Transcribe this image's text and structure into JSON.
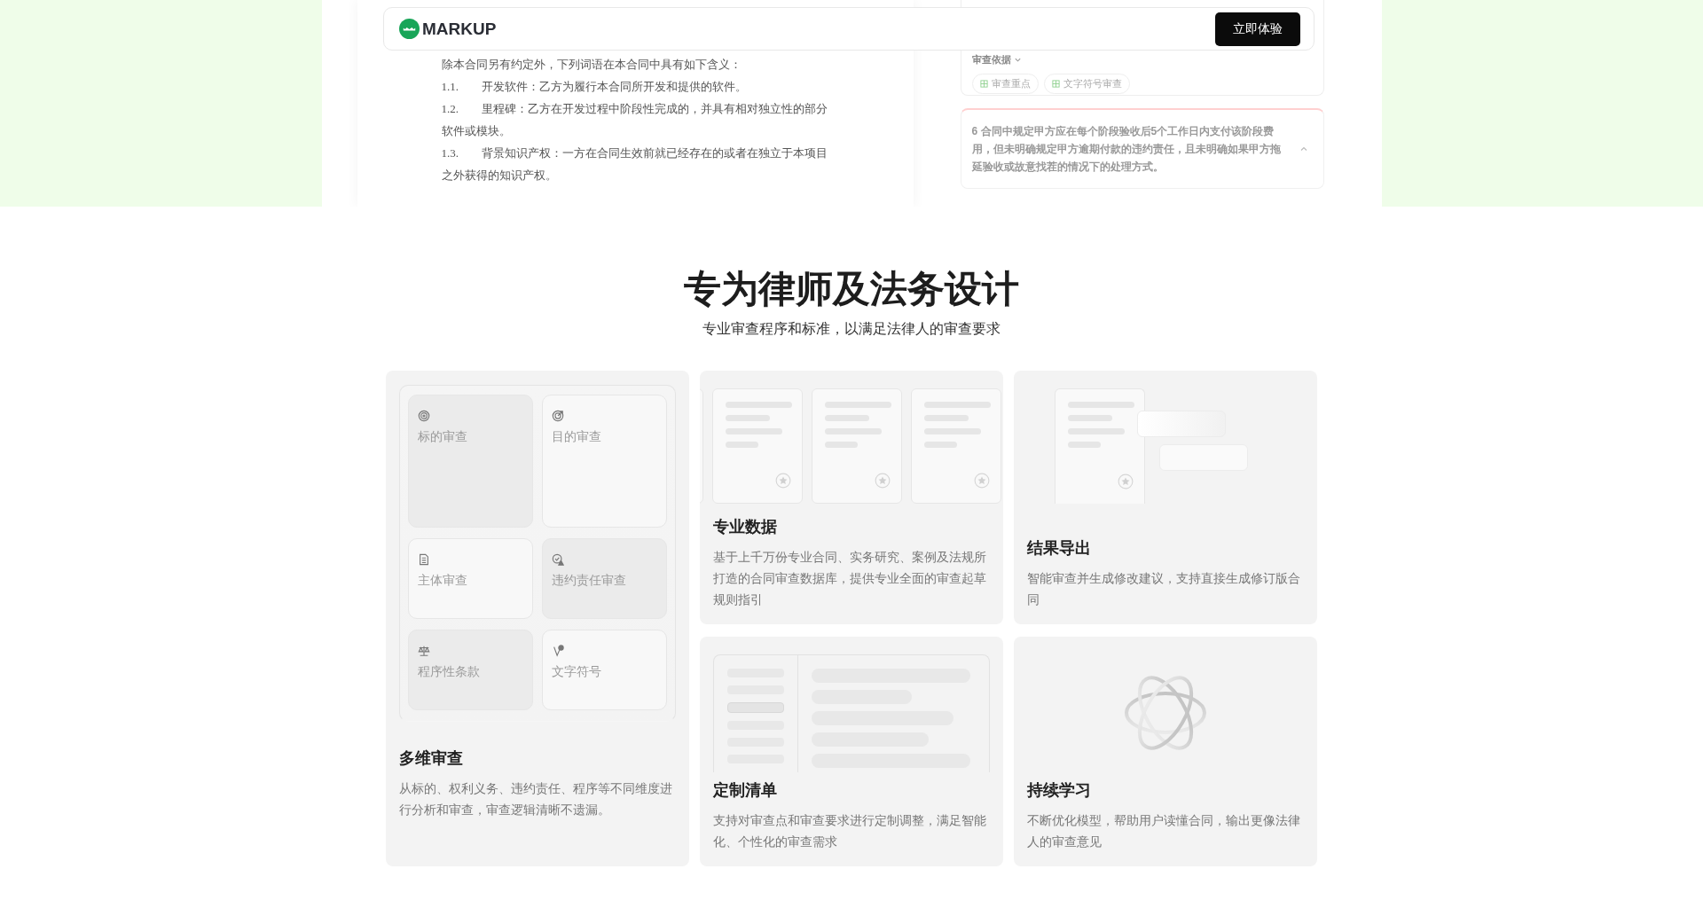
{
  "hero": {
    "document": {
      "lines": [
        {
          "text": "除本合同另有约定外，下列词语在本合同中具有如下含义："
        },
        {
          "number": "1.1.",
          "text": "开发软件：乙方为履行本合同所开发和提供的软件。"
        },
        {
          "number": "1.2.",
          "text": "里程碑：乙方在开发过程中阶段性完成的，并具有相对独立性的部分软件或模块。"
        },
        {
          "number": "1.3.",
          "text": "背景知识产权：一方在合同生效前就已经存在的或者在独立于本项目之外获得的知识产权。"
        }
      ]
    },
    "review_panel": {
      "basis_label": "审查依据",
      "tags": [
        "审查重点",
        "文字符号审查"
      ],
      "issue": {
        "text": "6 合同中规定甲方应在每个阶段验收后5个工作日内支付该阶段费用，但未明确规定甲方逾期付款的违约责任，且未明确如果甲方拖延验收或故意找茬的情况下的处理方式。",
        "expanded": true
      }
    }
  },
  "navbar": {
    "logo": "MARKUP",
    "cta": "立即体验"
  },
  "section": {
    "title": "专为律师及法务设计",
    "subtitle": "专业审查程序和标准，以满足法律人的审查要求"
  },
  "cards": [
    {
      "kind": "dimensions",
      "title": "多维审查",
      "description": "从标的、权利义务、违约责任、程序等不同维度进行分析和审查，审查逻辑清晰不遗漏。",
      "tiles": [
        {
          "label": "标的审查",
          "highlighted": true
        },
        {
          "label": "目的审查",
          "highlighted": false
        },
        {
          "label": "主体审查",
          "highlighted": false
        },
        {
          "label": "违约责任审查",
          "highlighted": true
        },
        {
          "label": "程序性条款",
          "highlighted": true
        },
        {
          "label": "文字符号",
          "highlighted": false
        }
      ]
    },
    {
      "kind": "documents",
      "title": "专业数据",
      "description": "基于上千万份专业合同、实务研究、案例及法规所打造的合同审查数据库，提供专业全面的审查起草规则指引"
    },
    {
      "kind": "export",
      "title": "结果导出",
      "description": "智能审查并生成修改建议，支持直接生成修订版合同"
    },
    {
      "kind": "checklist",
      "title": "定制清单",
      "description": "支持对审查点和审查要求进行定制调整，满足智能化、个性化的审查需求"
    },
    {
      "kind": "learning",
      "title": "持续学习",
      "description": "不断优化模型，帮助用户读懂合同，输出更像法律人的审查意见"
    }
  ]
}
